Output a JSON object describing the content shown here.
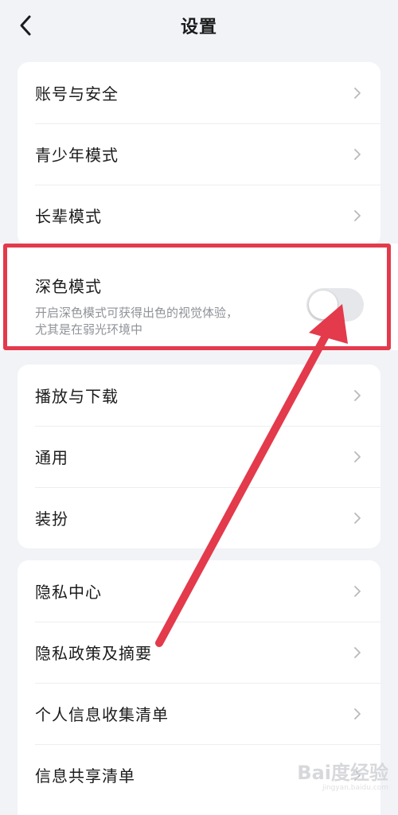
{
  "header": {
    "title": "设置"
  },
  "group1": [
    {
      "label": "账号与安全"
    },
    {
      "label": "青少年模式"
    },
    {
      "label": "长辈模式"
    }
  ],
  "dark_mode": {
    "label": "深色模式",
    "desc_line1": "开启深色模式可获得出色的视觉体验，",
    "desc_line2": "尤其是在弱光环境中",
    "enabled": false
  },
  "group2": [
    {
      "label": "播放与下载"
    },
    {
      "label": "通用"
    },
    {
      "label": "装扮"
    }
  ],
  "group3": [
    {
      "label": "隐私中心"
    },
    {
      "label": "隐私政策及摘要"
    },
    {
      "label": "个人信息收集清单"
    },
    {
      "label": "信息共享清单"
    }
  ],
  "colors": {
    "annotation": "#e33a4c",
    "background": "#f1f3f7"
  },
  "watermark": {
    "main": "Bai度经验",
    "sub": "jingyan.baidu.com"
  }
}
